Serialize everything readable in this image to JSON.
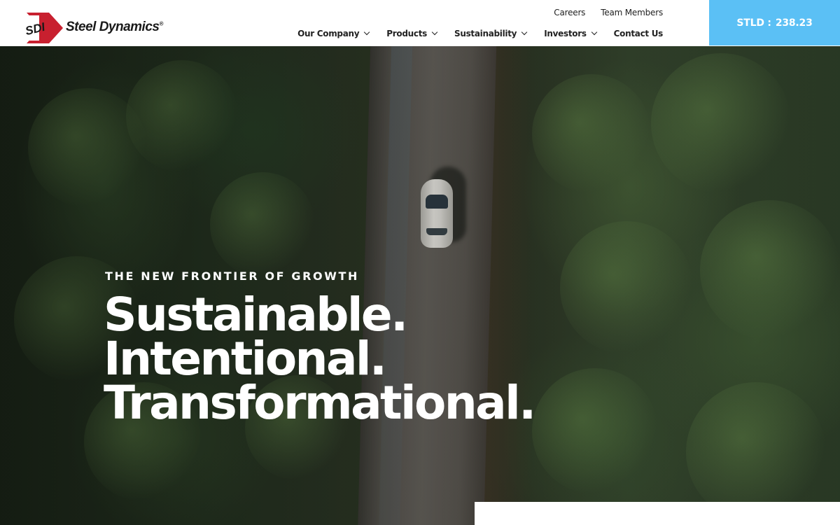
{
  "header": {
    "logo": {
      "mark": "SDI",
      "name": "Steel Dynamics",
      "registered": "®"
    },
    "top_links": [
      "Careers",
      "Team Members"
    ],
    "nav": [
      {
        "label": "Our Company",
        "has_dropdown": true
      },
      {
        "label": "Products",
        "has_dropdown": true
      },
      {
        "label": "Sustainability",
        "has_dropdown": true
      },
      {
        "label": "Investors",
        "has_dropdown": true
      },
      {
        "label": "Contact Us",
        "has_dropdown": false
      }
    ],
    "ticker": {
      "symbol": "STLD :",
      "price": "238.23"
    }
  },
  "hero": {
    "eyebrow": "THE NEW FRONTIER OF GROWTH",
    "headline": [
      "Sustainable.",
      "Intentional.",
      "Transformational."
    ]
  },
  "colors": {
    "brand_red": "#c8202f",
    "brand_dark": "#1a1a1a",
    "ticker_bg": "#5bc0f5",
    "hero_text": "#ffffff"
  },
  "icons": [
    "sdi-logo-icon",
    "chevron-down-icon"
  ]
}
